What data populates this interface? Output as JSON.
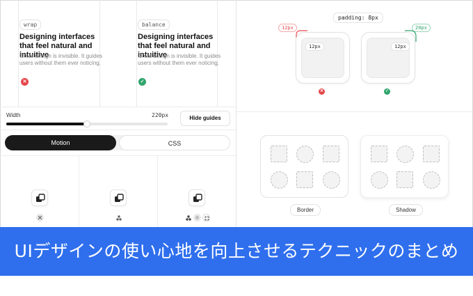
{
  "typography": {
    "left_example": {
      "mode": "wrap",
      "headline": "Designing interfaces that feel natural and intuitive",
      "body": "Great design is invisible. It guides users without them ever noticing.",
      "status": "bad"
    },
    "right_example": {
      "mode": "balance",
      "headline": "Designing interfaces that feel natural and intuitive",
      "body": "Great design is invisible. It guides users without them ever noticing.",
      "status": "good"
    }
  },
  "width_control": {
    "label": "Width",
    "value": "220px",
    "slider_fraction": 0.5,
    "hide_guides_label": "Hide guides"
  },
  "tabs": [
    {
      "label": "Motion",
      "active": true
    },
    {
      "label": "CSS",
      "active": false
    }
  ],
  "motion_icons": {
    "main_icon": "stacked-squares-icon",
    "sub_icons": [
      "close-circle-icon",
      "cluster-icon",
      "cluster-icon",
      "blur-icon",
      "shrink-icon"
    ]
  },
  "radius_demo": {
    "padding_label": "padding: 8px",
    "bad": {
      "outer_label": "12px",
      "inner_label": "12px",
      "status": "bad"
    },
    "good": {
      "outer_label": "20px",
      "inner_label": "12px",
      "status": "good"
    }
  },
  "shape_demo": {
    "border_label": "Border",
    "shadow_label": "Shadow"
  },
  "banner": {
    "title": "UIデザインの使い心地を向上させるテクニックのまとめ"
  },
  "colors": {
    "banner": "#2f6fed",
    "bad": "#e5484d",
    "good": "#30a46c"
  }
}
